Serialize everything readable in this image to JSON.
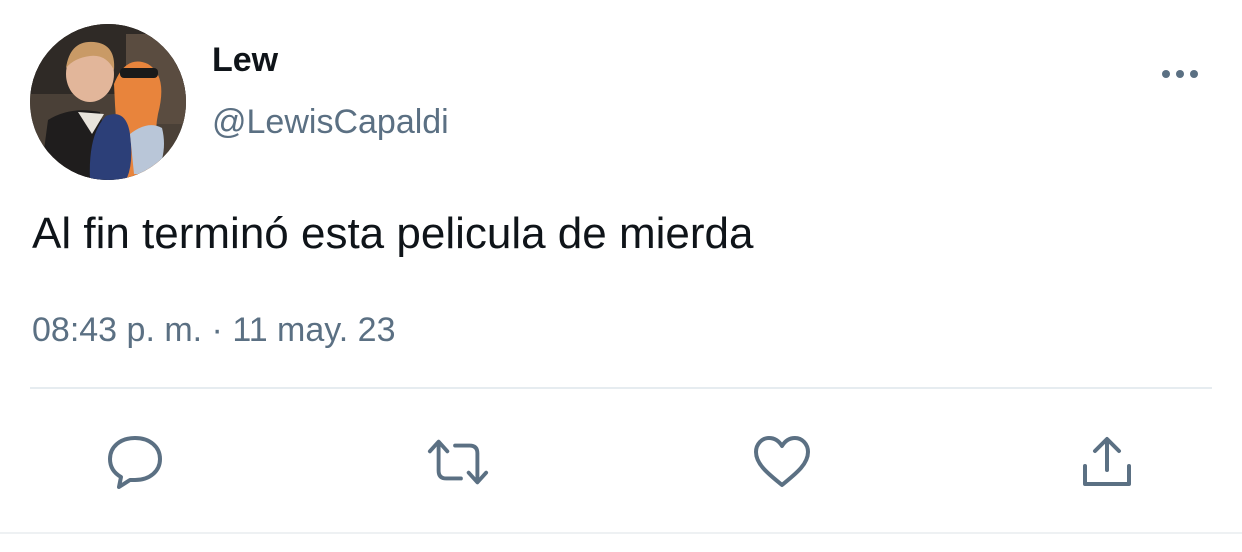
{
  "tweet": {
    "author": {
      "display_name": "Lew",
      "handle": "@LewisCapaldi"
    },
    "text": "Al fin terminó esta pelicula de mierda",
    "timestamp": "08:43 p. m. · 11 may. 23"
  },
  "actions": [
    {
      "name": "reply",
      "icon": "reply-icon"
    },
    {
      "name": "retweet",
      "icon": "retweet-icon"
    },
    {
      "name": "like",
      "icon": "heart-icon"
    },
    {
      "name": "share",
      "icon": "share-icon"
    }
  ],
  "colors": {
    "text_primary": "#0f1419",
    "text_secondary": "#5b7083",
    "divider": "#e6ecf0",
    "background": "#ffffff"
  }
}
